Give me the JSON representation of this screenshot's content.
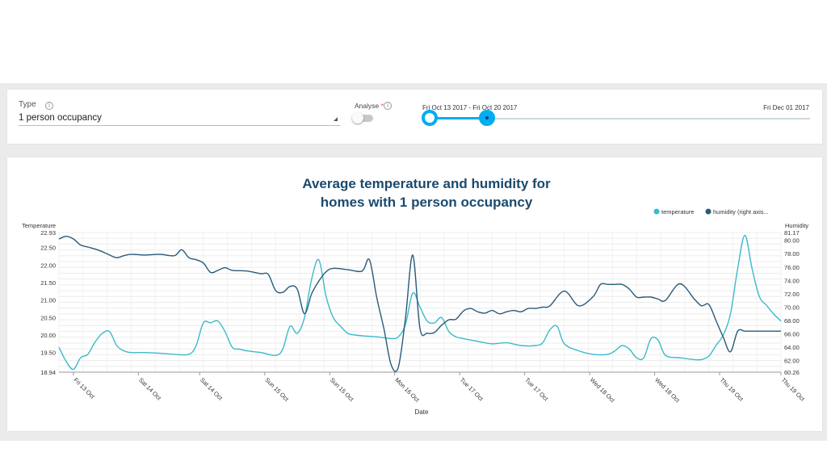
{
  "controls": {
    "type_label": "Type",
    "type_value": "1 person occupancy",
    "analyse_label": "Analyse",
    "analyse_required": "*",
    "analyse_on": false,
    "range_label": "Fri Oct 13 2017 - Fri Oct 20 2017",
    "range_end_label": "Fri Dec 01 2017",
    "accent": "#00aeef"
  },
  "chart_data": {
    "type": "line",
    "title": "Average temperature and humidity for homes with 1 person occupancy",
    "title_lines": [
      "Average temperature and humidity for",
      "homes with 1 person occupancy"
    ],
    "xlabel": "Date",
    "ylabel_left": "Temperature",
    "ylabel_right": "Humidity",
    "ylim_left": [
      18.94,
      22.93
    ],
    "ylim_right": [
      60.26,
      81.17
    ],
    "yticks_left": [
      "22.93",
      "22.50",
      "22.00",
      "21.50",
      "21.00",
      "20.50",
      "20.00",
      "19.50",
      "18.94"
    ],
    "ytick_values_left": [
      22.93,
      22.5,
      22.0,
      21.5,
      21.0,
      20.5,
      20.0,
      19.5,
      18.94
    ],
    "yticks_right": [
      "81.17",
      "80.00",
      "78.00",
      "76.00",
      "74.00",
      "72.00",
      "70.00",
      "68.00",
      "66.00",
      "64.00",
      "62.00",
      "60.26"
    ],
    "ytick_values_right": [
      81.17,
      80.0,
      78.0,
      76.0,
      74.0,
      72.0,
      70.0,
      68.0,
      66.0,
      64.0,
      62.0,
      60.26
    ],
    "xticks": [
      "Fri 13 Oct",
      "Sat 14 Oct",
      "Sat 14 Oct",
      "Sun 15 Oct",
      "Sun 15 Oct",
      "Mon 16 Oct",
      "Tue 17 Oct",
      "Tue 17 Oct",
      "Wed 18 Oct",
      "Wed 18 Oct",
      "Thu 19 Oct",
      "Thu 19 Oct"
    ],
    "xtick_positions": [
      0.02,
      0.11,
      0.195,
      0.285,
      0.375,
      0.465,
      0.555,
      0.645,
      0.735,
      0.825,
      0.915,
      1.0
    ],
    "legend_position": "top-right",
    "grid": true,
    "series": [
      {
        "name": "temperature",
        "axis": "left",
        "color": "#3cbac8",
        "x": [
          0,
          0.01,
          0.02,
          0.03,
          0.04,
          0.05,
          0.06,
          0.07,
          0.08,
          0.09,
          0.1,
          0.11,
          0.12,
          0.14,
          0.16,
          0.18,
          0.19,
          0.2,
          0.21,
          0.22,
          0.23,
          0.24,
          0.25,
          0.26,
          0.28,
          0.3,
          0.31,
          0.32,
          0.33,
          0.34,
          0.35,
          0.36,
          0.37,
          0.38,
          0.39,
          0.4,
          0.41,
          0.42,
          0.44,
          0.46,
          0.47,
          0.48,
          0.49,
          0.5,
          0.51,
          0.52,
          0.53,
          0.54,
          0.55,
          0.56,
          0.58,
          0.6,
          0.62,
          0.64,
          0.66,
          0.67,
          0.68,
          0.69,
          0.7,
          0.72,
          0.74,
          0.76,
          0.77,
          0.78,
          0.79,
          0.8,
          0.81,
          0.82,
          0.83,
          0.84,
          0.86,
          0.88,
          0.89,
          0.9,
          0.91,
          0.92,
          0.93,
          0.94,
          0.95,
          0.96,
          0.97,
          0.98,
          0.99,
          1.0
        ],
        "y": [
          19.65,
          19.25,
          19.02,
          19.35,
          19.45,
          19.8,
          20.05,
          20.1,
          19.7,
          19.55,
          19.5,
          19.5,
          19.5,
          19.48,
          19.45,
          19.45,
          19.7,
          20.35,
          20.35,
          20.4,
          20.1,
          19.65,
          19.6,
          19.55,
          19.5,
          19.42,
          19.6,
          20.25,
          20.05,
          20.5,
          21.6,
          22.15,
          21.1,
          20.5,
          20.25,
          20.05,
          20.0,
          19.98,
          19.95,
          19.9,
          19.95,
          20.3,
          21.2,
          20.8,
          20.4,
          20.35,
          20.5,
          20.1,
          19.95,
          19.9,
          19.82,
          19.75,
          19.78,
          19.7,
          19.7,
          19.78,
          20.15,
          20.25,
          19.75,
          19.55,
          19.45,
          19.45,
          19.55,
          19.7,
          19.6,
          19.35,
          19.35,
          19.9,
          19.85,
          19.42,
          19.35,
          19.3,
          19.3,
          19.4,
          19.7,
          20.0,
          20.6,
          21.9,
          22.85,
          21.9,
          21.1,
          20.85,
          20.6,
          20.4
        ]
      },
      {
        "name": "humidity (right axis...",
        "axis": "right",
        "color": "#2a5a78",
        "x": [
          0,
          0.01,
          0.02,
          0.03,
          0.04,
          0.05,
          0.06,
          0.07,
          0.08,
          0.09,
          0.1,
          0.12,
          0.14,
          0.16,
          0.17,
          0.18,
          0.19,
          0.2,
          0.21,
          0.22,
          0.23,
          0.24,
          0.26,
          0.28,
          0.29,
          0.3,
          0.31,
          0.32,
          0.33,
          0.34,
          0.35,
          0.36,
          0.37,
          0.38,
          0.4,
          0.42,
          0.43,
          0.44,
          0.45,
          0.46,
          0.47,
          0.48,
          0.49,
          0.5,
          0.51,
          0.52,
          0.53,
          0.54,
          0.55,
          0.56,
          0.57,
          0.58,
          0.59,
          0.6,
          0.61,
          0.62,
          0.63,
          0.64,
          0.65,
          0.66,
          0.67,
          0.68,
          0.7,
          0.72,
          0.74,
          0.75,
          0.76,
          0.77,
          0.78,
          0.79,
          0.8,
          0.81,
          0.82,
          0.83,
          0.84,
          0.86,
          0.88,
          0.89,
          0.9,
          0.91,
          0.92,
          0.93,
          0.94,
          0.95,
          0.96,
          0.97,
          0.98,
          0.99,
          1.0
        ],
        "y": [
          80.2,
          80.6,
          80.2,
          79.3,
          79.0,
          78.7,
          78.3,
          77.8,
          77.4,
          77.7,
          77.9,
          77.8,
          77.9,
          77.7,
          78.6,
          77.4,
          77.1,
          76.6,
          75.2,
          75.5,
          75.9,
          75.5,
          75.4,
          75.0,
          74.9,
          72.5,
          72.2,
          73.1,
          72.7,
          69.0,
          72.0,
          73.9,
          75.3,
          75.8,
          75.6,
          75.4,
          77.1,
          71.5,
          66.8,
          61.4,
          61.0,
          68.4,
          77.8,
          66.8,
          66.1,
          66.2,
          67.3,
          68.1,
          68.2,
          69.4,
          69.8,
          69.3,
          69.1,
          69.5,
          69.0,
          69.3,
          69.5,
          69.3,
          69.8,
          69.8,
          70.0,
          70.2,
          72.4,
          70.2,
          71.6,
          73.4,
          73.4,
          73.4,
          73.4,
          72.7,
          71.5,
          71.5,
          71.5,
          71.2,
          71.0,
          73.5,
          71.2,
          70.2,
          70.4,
          68.0,
          65.5,
          63.3,
          66.4,
          66.4,
          66.4,
          66.4,
          66.4,
          66.4,
          66.4
        ]
      }
    ]
  }
}
